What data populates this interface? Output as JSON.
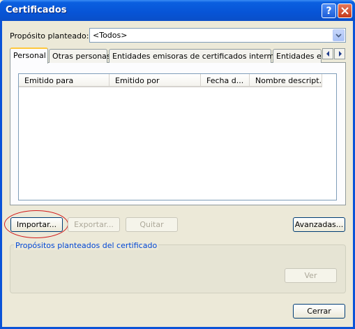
{
  "window": {
    "title": "Certificados"
  },
  "purpose": {
    "label": "Propósito planteado:",
    "value": "<Todos>"
  },
  "tabs": [
    {
      "label": "Personal"
    },
    {
      "label": "Otras personas"
    },
    {
      "label": "Entidades emisoras de certificados intermedias"
    },
    {
      "label": "Entidades emi"
    }
  ],
  "list": {
    "columns": [
      {
        "label": "Emitido para"
      },
      {
        "label": "Emitido por"
      },
      {
        "label": "Fecha d..."
      },
      {
        "label": "Nombre descript..."
      }
    ]
  },
  "buttons": {
    "import": "Importar...",
    "export": "Exportar...",
    "remove": "Quitar",
    "advanced": "Avanzadas...",
    "view": "Ver",
    "close": "Cerrar"
  },
  "group": {
    "label": "Propósitos planteados del certificado"
  },
  "annotation": {
    "color": "#d11a1a"
  },
  "icons": {
    "help": "help-icon",
    "close": "close-icon",
    "combo_arrow": "chevron-down-icon",
    "tab_left": "chevron-left-icon",
    "tab_right": "chevron-right-icon"
  }
}
